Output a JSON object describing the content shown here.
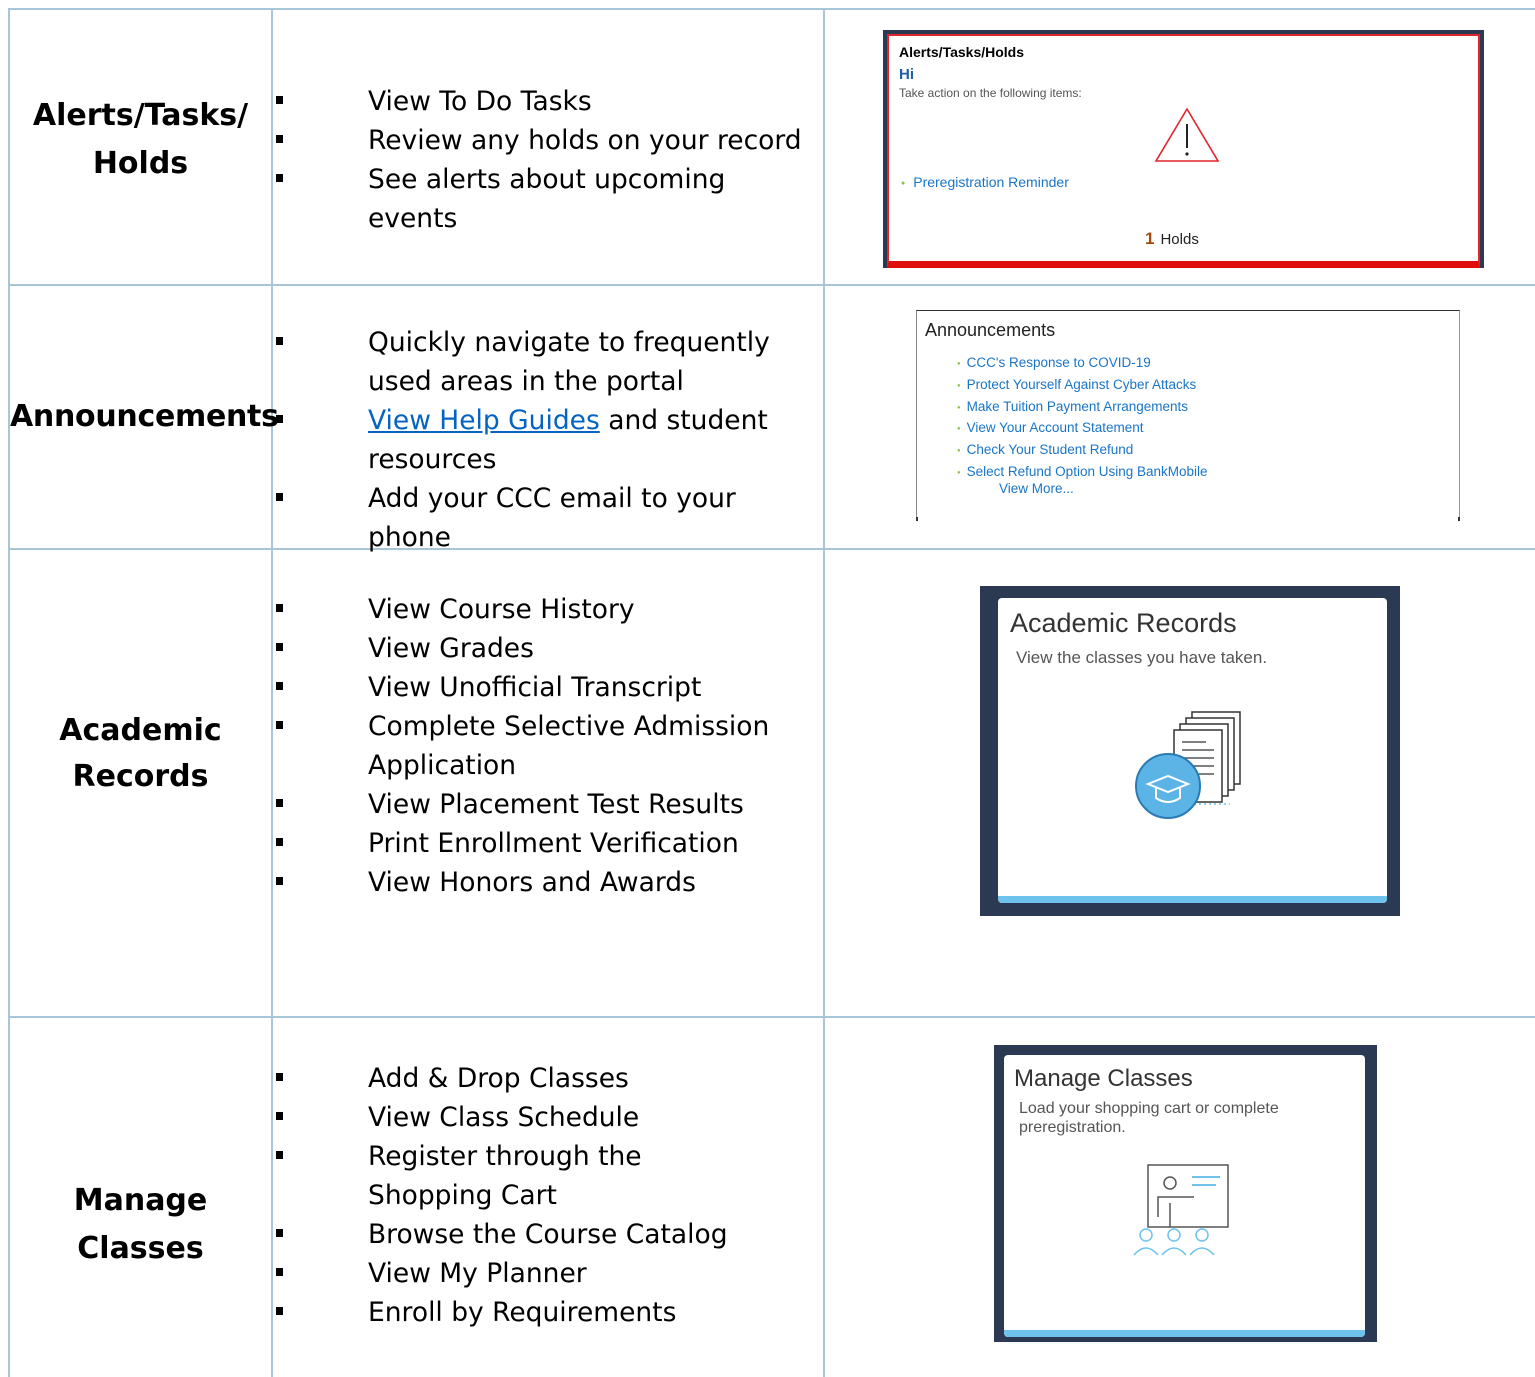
{
  "rows": [
    {
      "label": "Alerts/Tasks/\nHolds",
      "bullets": [
        "View To Do Tasks",
        "Review any holds on your record",
        "See alerts about upcoming events"
      ]
    },
    {
      "label": "Announcements",
      "bullets": [
        "Quickly navigate to frequently used areas in the portal",
        {
          "link": "View Help Guides",
          "rest": " and student resources"
        },
        "Add your CCC email to your phone"
      ]
    },
    {
      "label": "Academic\nRecords",
      "bullets": [
        "View Course History",
        "View Grades",
        "View Unofficial Transcript",
        "Complete Selective Admission Application",
        "View Placement Test Results",
        "Print Enrollment Verification",
        "View Honors and Awards"
      ]
    },
    {
      "label": "Manage Classes",
      "bullets": [
        "Add & Drop Classes",
        "View Class Schedule",
        "Register through the Shopping Cart",
        "Browse the Course Catalog",
        "View My Planner",
        "Enroll by Requirements"
      ]
    }
  ],
  "alerts_tile": {
    "title": "Alerts/Tasks/Holds",
    "greeting": "Hi",
    "subtitle": "Take action on the following items:",
    "link": "Preregistration Reminder",
    "holds_count": "1",
    "holds_label": "Holds",
    "icon": "warning-triangle-icon",
    "accent": "#e1262b"
  },
  "announcements_tile": {
    "title": "Announcements",
    "items": [
      "CCC's Response to COVID-19",
      "Protect Yourself Against Cyber Attacks",
      "Make Tuition Payment Arrangements",
      "View Your Account Statement",
      "Check Your Student Refund",
      "Select Refund Option Using BankMobile"
    ],
    "more": "View More..."
  },
  "academic_tile": {
    "title": "Academic Records",
    "subtitle": "View the classes you have taken.",
    "icon": "documents-graduation-cap-icon"
  },
  "manage_tile": {
    "title": "Manage Classes",
    "subtitle": "Load your shopping cart or complete preregistration.",
    "icon": "classroom-presenter-icon"
  },
  "colors": {
    "grid_line": "#a9c6d8",
    "link": "#1a75c8",
    "tile_frame": "#2b3a52",
    "tile_bar": "#6ec2ec"
  }
}
